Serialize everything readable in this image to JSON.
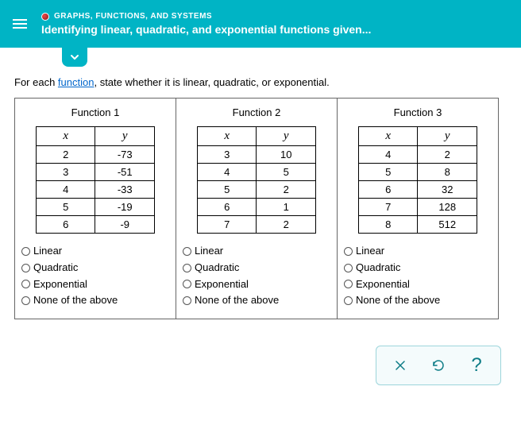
{
  "header": {
    "context": "GRAPHS, FUNCTIONS, AND SYSTEMS",
    "title": "Identifying linear, quadratic, and exponential functions given..."
  },
  "prompt": {
    "pre": "For each ",
    "link": "function",
    "post": ", state whether it is linear, quadratic, or exponential."
  },
  "columns": {
    "x_header": "x",
    "y_header": "y"
  },
  "functions": [
    {
      "title": "Function 1",
      "rows": [
        {
          "x": "2",
          "y": "-73"
        },
        {
          "x": "3",
          "y": "-51"
        },
        {
          "x": "4",
          "y": "-33"
        },
        {
          "x": "5",
          "y": "-19"
        },
        {
          "x": "6",
          "y": "-9"
        }
      ]
    },
    {
      "title": "Function 2",
      "rows": [
        {
          "x": "3",
          "y": "10"
        },
        {
          "x": "4",
          "y": "5"
        },
        {
          "x": "5",
          "y": "2"
        },
        {
          "x": "6",
          "y": "1"
        },
        {
          "x": "7",
          "y": "2"
        }
      ]
    },
    {
      "title": "Function 3",
      "rows": [
        {
          "x": "4",
          "y": "2"
        },
        {
          "x": "5",
          "y": "8"
        },
        {
          "x": "6",
          "y": "32"
        },
        {
          "x": "7",
          "y": "128"
        },
        {
          "x": "8",
          "y": "512"
        }
      ]
    }
  ],
  "options": [
    "Linear",
    "Quadratic",
    "Exponential",
    "None of the above"
  ]
}
